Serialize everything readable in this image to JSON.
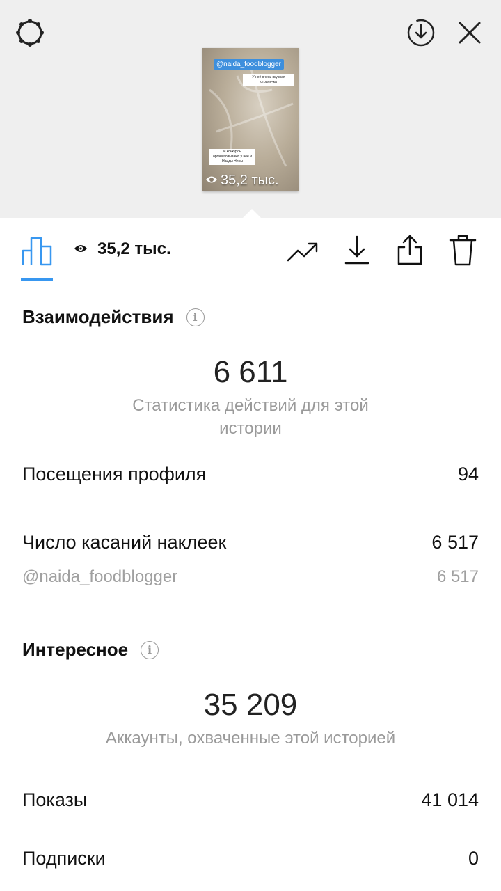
{
  "header": {
    "thumbnail": {
      "mention": "@naida_foodblogger",
      "caption_top": "У неё очень вкусная страничка",
      "caption_bottom": "И конкурсы организовывают у неё и Наиды Нины",
      "views": "35,2 тыс."
    }
  },
  "toolbar": {
    "views_count": "35,2 тыс."
  },
  "interactions": {
    "title": "Взаимодействия",
    "total": "6 611",
    "subtitle": "Статистика действий для этой истории",
    "rows": [
      {
        "label": "Посещения профиля",
        "value": "94"
      },
      {
        "label": "Число касаний наклеек",
        "value": "6 517"
      },
      {
        "label": "@naida_foodblogger",
        "value": "6 517"
      }
    ]
  },
  "discovery": {
    "title": "Интересное",
    "total": "35 209",
    "subtitle": "Аккаунты, охваченные этой историей",
    "rows": [
      {
        "label": "Показы",
        "value": "41 014"
      },
      {
        "label": "Подписки",
        "value": "0"
      }
    ]
  },
  "colors": {
    "accent": "#3897f0",
    "muted": "#9a9a9a",
    "top_background": "#efefef"
  },
  "icons": [
    "settings-icon",
    "download-circle-icon",
    "close-icon",
    "eye-icon",
    "bar-chart-icon",
    "trending-icon",
    "download-icon",
    "share-icon",
    "trash-icon",
    "info-icon"
  ]
}
